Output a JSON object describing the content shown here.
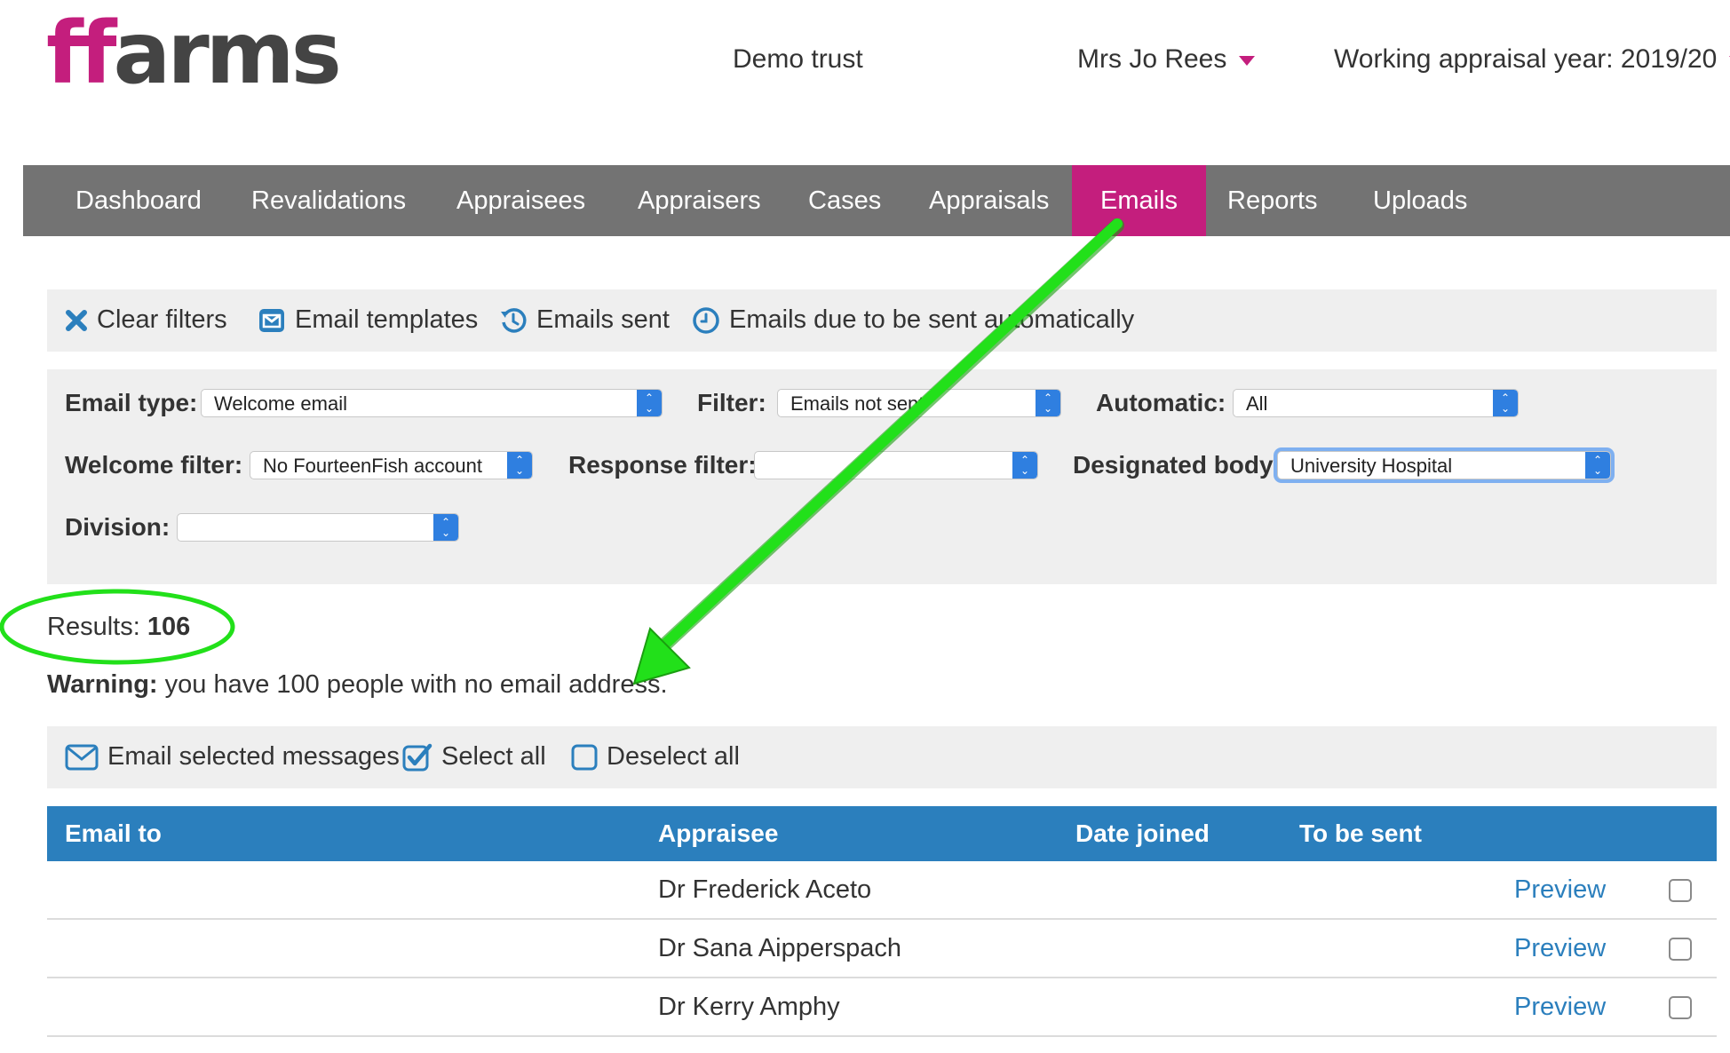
{
  "header": {
    "logo_ff": "ff",
    "logo_rest": "arms",
    "trust": "Demo trust",
    "user": "Mrs Jo Rees",
    "appraisal_year": "Working appraisal year: 2019/20"
  },
  "nav": {
    "items": [
      "Dashboard",
      "Revalidations",
      "Appraisees",
      "Appraisers",
      "Cases",
      "Appraisals",
      "Emails",
      "Reports",
      "Uploads"
    ],
    "active": "Emails"
  },
  "toolbar": {
    "clear_filters": "Clear filters",
    "email_templates": "Email templates",
    "emails_sent": "Emails sent",
    "emails_due": "Emails due to be sent automatically"
  },
  "filters": {
    "email_type_label": "Email type:",
    "email_type_value": "Welcome email",
    "filter_label": "Filter:",
    "filter_value": "Emails not sent",
    "automatic_label": "Automatic:",
    "automatic_value": "All",
    "welcome_filter_label": "Welcome filter:",
    "welcome_filter_value": "No FourteenFish account",
    "response_filter_label": "Response filter:",
    "response_filter_value": "",
    "designated_body_label": "Designated body:",
    "designated_body_value": "University Hospital",
    "division_label": "Division:",
    "division_value": ""
  },
  "results": {
    "label": "Results:",
    "count": "106"
  },
  "warning": {
    "label": "Warning:",
    "text": "you have 100 people with no email address."
  },
  "actions": {
    "email_selected": "Email selected messages",
    "select_all": "Select all",
    "deselect_all": "Deselect all"
  },
  "table": {
    "headers": [
      "Email to",
      "Appraisee",
      "Date joined",
      "To be sent"
    ],
    "rows": [
      {
        "email_to": "",
        "appraisee": "Dr Frederick Aceto",
        "date_joined": "",
        "to_be_sent": "",
        "action": "Preview"
      },
      {
        "email_to": "",
        "appraisee": "Dr Sana Aipperspach",
        "date_joined": "",
        "to_be_sent": "",
        "action": "Preview"
      },
      {
        "email_to": "",
        "appraisee": "Dr Kerry Amphy",
        "date_joined": "",
        "to_be_sent": "",
        "action": "Preview"
      }
    ]
  },
  "colors": {
    "brand": "#c41e7d",
    "nav_bg": "#737373",
    "table_header": "#2b7fbd",
    "annotation": "#22e01a"
  }
}
